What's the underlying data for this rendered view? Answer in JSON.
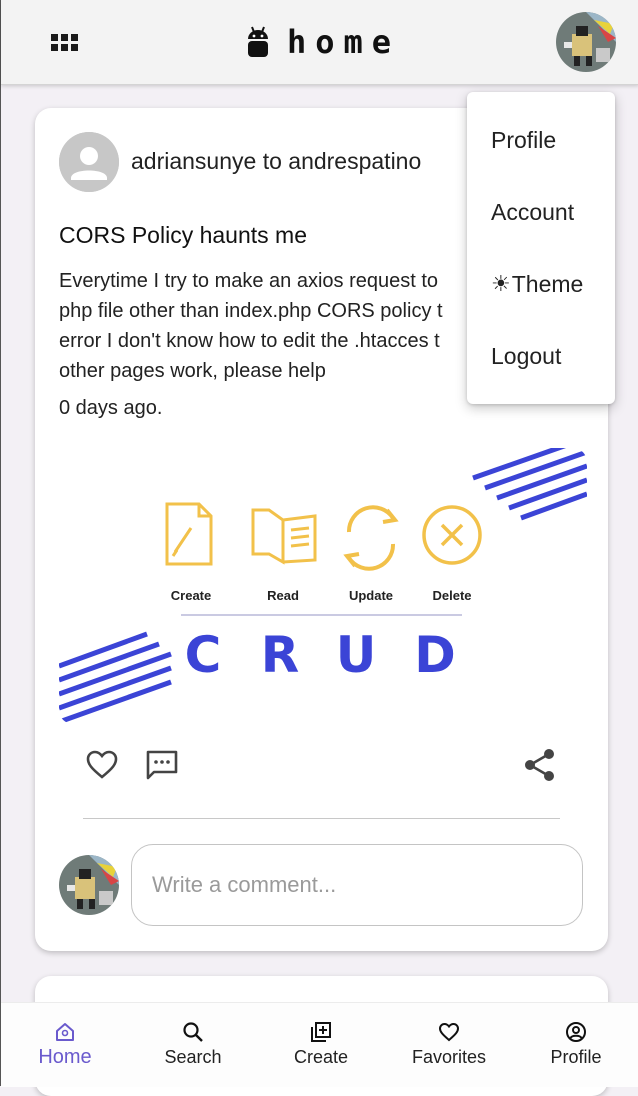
{
  "header": {
    "title": "home",
    "menu_icon": "grid-icon",
    "logo_icon": "android-icon",
    "avatar": "user-avatar"
  },
  "post": {
    "author": "adriansunye",
    "recipient": "andrespatino",
    "author_line": "adriansunye to andrespatino",
    "title": "CORS Policy haunts me",
    "body": "Everytime I try to make an axios request to a php file other than index.php CORS policy t error I don't know how to edit the .htacces t other pages work, please help",
    "body_lines": [
      "Everytime I try to make an axios request to",
      "php file other than index.php CORS policy t",
      "error I don't know how to edit the .htacces t",
      "other pages work, please help"
    ],
    "time": "0 days ago.",
    "image": {
      "labels": [
        "Create",
        "Read",
        "Update",
        "Delete"
      ],
      "heading": "C R U D",
      "letters": [
        "C",
        "R",
        "U",
        "D"
      ]
    },
    "actions": {
      "like_icon": "heart-icon",
      "comment_icon": "comment-icon",
      "share_icon": "share-icon"
    },
    "comment_placeholder": "Write a comment..."
  },
  "dropdown": {
    "items": [
      {
        "label": "Profile"
      },
      {
        "label": "Account"
      },
      {
        "label": "Theme",
        "icon": "☀"
      },
      {
        "label": "Logout"
      }
    ]
  },
  "bottom_nav": {
    "items": [
      {
        "label": "Home",
        "icon": "home-icon",
        "active": true
      },
      {
        "label": "Search",
        "icon": "search-icon"
      },
      {
        "label": "Create",
        "icon": "add-box-icon"
      },
      {
        "label": "Favorites",
        "icon": "heart-icon"
      },
      {
        "label": "Profile",
        "icon": "account-circle-icon"
      }
    ]
  },
  "colors": {
    "accent": "#6a5acd",
    "crud_blue": "#3b44d6",
    "crud_yellow": "#f2c14a"
  }
}
